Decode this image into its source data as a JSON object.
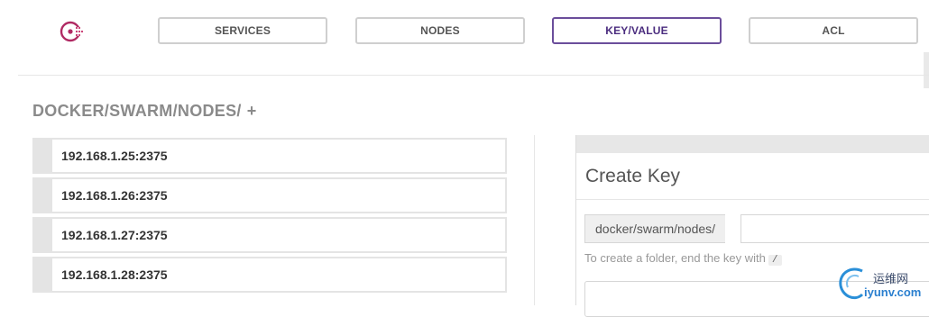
{
  "nav": {
    "logo_icon": "consul-logo-icon",
    "items": [
      {
        "label": "SERVICES",
        "active": false
      },
      {
        "label": "NODES",
        "active": false
      },
      {
        "label": "KEY/VALUE",
        "active": true
      },
      {
        "label": "ACL",
        "active": false
      }
    ]
  },
  "breadcrumb": {
    "path": "DOCKER/SWARM/NODES/",
    "add_label": "+"
  },
  "keys": [
    {
      "label": "192.168.1.25:2375"
    },
    {
      "label": "192.168.1.26:2375"
    },
    {
      "label": "192.168.1.27:2375"
    },
    {
      "label": "192.168.1.28:2375"
    }
  ],
  "create_key": {
    "title": "Create Key",
    "prefix": "docker/swarm/nodes/",
    "key_value": "",
    "help_text": "To create a folder, end the key with",
    "help_code": "/",
    "value_text": ""
  },
  "watermark": {
    "cn": "运维网",
    "url": "iyunv.com"
  },
  "colors": {
    "accent": "#6b4e9b",
    "logo": "#c6306b",
    "border": "#e4e4e4"
  }
}
